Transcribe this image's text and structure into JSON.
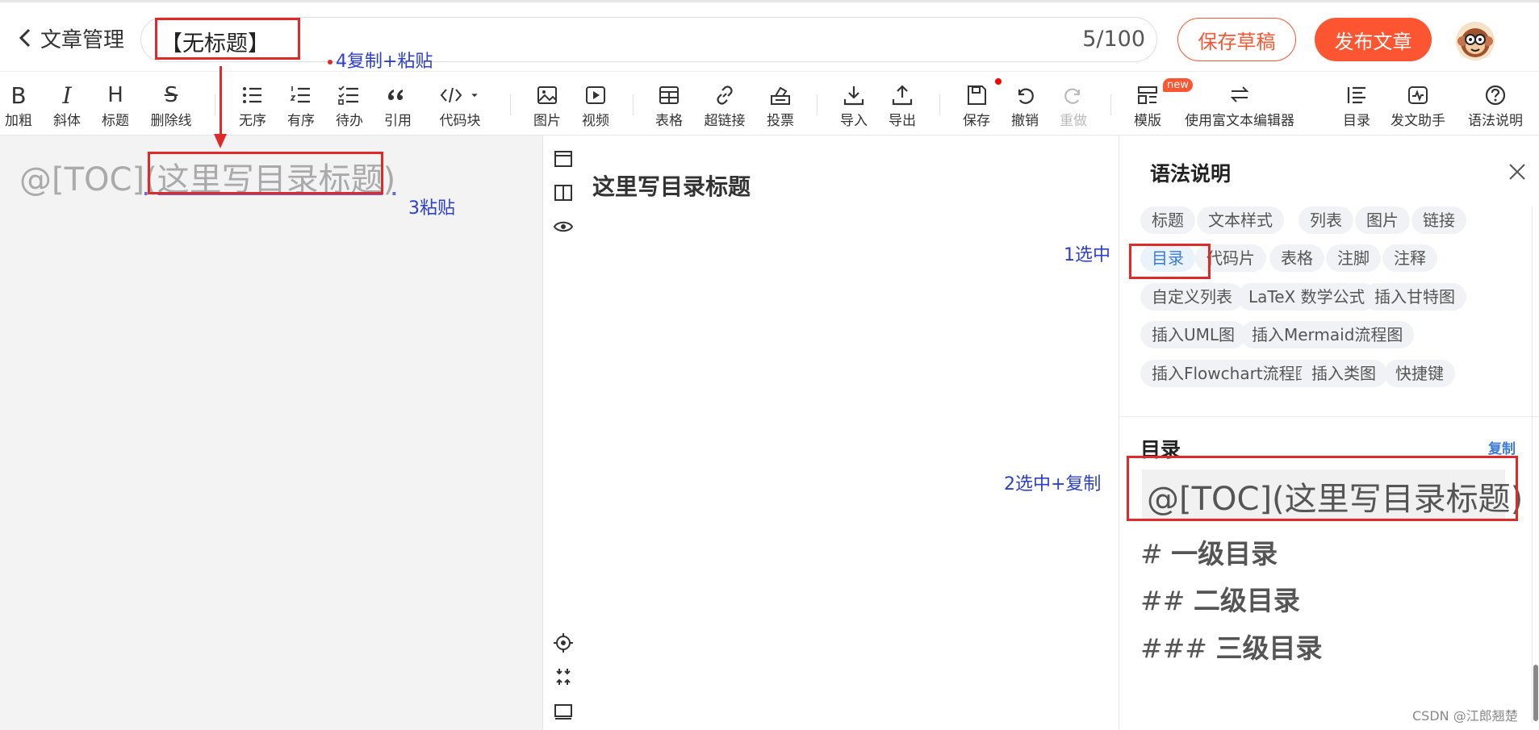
{
  "header": {
    "back_label": "文章管理",
    "title_value": "【无标题】",
    "title_count": "5/100",
    "save_draft": "保存草稿",
    "publish": "发布文章"
  },
  "toolbar": {
    "bold": {
      "glyph": "B",
      "label": "加粗"
    },
    "italic": {
      "glyph": "I",
      "label": "斜体"
    },
    "heading": {
      "glyph": "H",
      "label": "标题"
    },
    "strike": {
      "glyph": "S",
      "label": "删除线"
    },
    "unordered": "无序",
    "ordered": "有序",
    "todo": "待办",
    "quote": "引用",
    "codeblock": "代码块",
    "image": "图片",
    "video": "视频",
    "table": "表格",
    "link": "超链接",
    "vote": "投票",
    "import": "导入",
    "export": "导出",
    "save": "保存",
    "undo": "撤销",
    "redo": "重做",
    "template": "模版",
    "template_badge": "new",
    "rich_text": "使用富文本编辑器",
    "toc": "目录",
    "assistant": "发文助手",
    "syntax_help": "语法说明"
  },
  "editor": {
    "text_prefix": "@[TOC]",
    "text_selected": "(这里写目录标题)"
  },
  "preview": {
    "heading": "这里写目录标题"
  },
  "panel": {
    "title": "语法说明",
    "chips": [
      "标题",
      "文本样式",
      "列表",
      "图片",
      "链接",
      "目录",
      "代码片",
      "表格",
      "注脚",
      "注释",
      "自定义列表",
      "LaTeX 数学公式",
      "插入甘特图",
      "插入UML图",
      "插入Mermaid流程图",
      "插入Flowchart流程图",
      "插入类图",
      "快捷键"
    ],
    "section_title": "目录",
    "copy": "复制",
    "code": "@[TOC](这里写目录标题)",
    "md_lines": [
      {
        "hash": "#",
        "text": "一级目录"
      },
      {
        "hash": "##",
        "text": "二级目录"
      },
      {
        "hash": "###",
        "text": "三级目录"
      }
    ]
  },
  "annotations": {
    "step1": "1选中",
    "step2": "2选中+复制",
    "step3": "3粘贴",
    "step4": "4复制+粘贴"
  },
  "watermark": "CSDN @江郎翘楚",
  "colors": {
    "accent": "#fc5531",
    "annotation_text": "#2c3fd0",
    "annotation_box": "#e02a2a",
    "link": "#3b7bd6"
  }
}
